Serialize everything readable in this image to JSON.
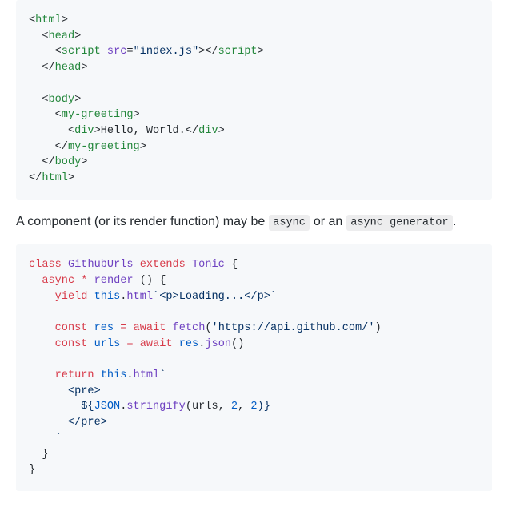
{
  "code1": {
    "l1a": "<",
    "l1b": "html",
    "l1c": ">",
    "l2a": "  <",
    "l2b": "head",
    "l2c": ">",
    "l3a": "    <",
    "l3b": "script",
    "l3c": " src",
    "l3d": "=",
    "l3e": "\"index.js\"",
    "l3f": "></",
    "l3g": "script",
    "l3h": ">",
    "l4a": "  </",
    "l4b": "head",
    "l4c": ">",
    "l5": "",
    "l6a": "  <",
    "l6b": "body",
    "l6c": ">",
    "l7a": "    <",
    "l7b": "my-greeting",
    "l7c": ">",
    "l8a": "      <",
    "l8b": "div",
    "l8c": ">Hello, World.</",
    "l8d": "div",
    "l8e": ">",
    "l9a": "    </",
    "l9b": "my-greeting",
    "l9c": ">",
    "l10a": "  </",
    "l10b": "body",
    "l10c": ">",
    "l11a": "</",
    "l11b": "html",
    "l11c": ">"
  },
  "prose": {
    "part1": "A component (or its render function) may be ",
    "inline1": "async",
    "part2": " or an ",
    "inline2": "async generator",
    "part3": "."
  },
  "code2": {
    "l1a": "class",
    "l1b": " ",
    "l1c": "GithubUrls",
    "l1d": " ",
    "l1e": "extends",
    "l1f": " ",
    "l1g": "Tonic",
    "l1h": " {",
    "l2a": "  ",
    "l2b": "async",
    "l2c": " ",
    "l2d": "*",
    "l2e": " ",
    "l2f": "render",
    "l2g": " () {",
    "l3a": "    ",
    "l3b": "yield",
    "l3c": " ",
    "l3d": "this",
    "l3e": ".",
    "l3f": "html",
    "l3g": "`<p>Loading...</p>`",
    "l4": "",
    "l5a": "    ",
    "l5b": "const",
    "l5c": " ",
    "l5d": "res",
    "l5e": " ",
    "l5f": "=",
    "l5g": " ",
    "l5h": "await",
    "l5i": " ",
    "l5j": "fetch",
    "l5k": "(",
    "l5l": "'https://api.github.com/'",
    "l5m": ")",
    "l6a": "    ",
    "l6b": "const",
    "l6c": " ",
    "l6d": "urls",
    "l6e": " ",
    "l6f": "=",
    "l6g": " ",
    "l6h": "await",
    "l6i": " ",
    "l6j": "res",
    "l6k": ".",
    "l6l": "json",
    "l6m": "()",
    "l7": "",
    "l8a": "    ",
    "l8b": "return",
    "l8c": " ",
    "l8d": "this",
    "l8e": ".",
    "l8f": "html",
    "l8g": "`",
    "l9a": "      <pre>",
    "l10a": "        ${",
    "l10b": "JSON",
    "l10c": ".",
    "l10d": "stringify",
    "l10e": "(urls, ",
    "l10f": "2",
    "l10g": ", ",
    "l10h": "2",
    "l10i": ")}",
    "l11a": "      </pre>",
    "l12a": "    `",
    "l13a": "  }",
    "l14a": "}"
  }
}
